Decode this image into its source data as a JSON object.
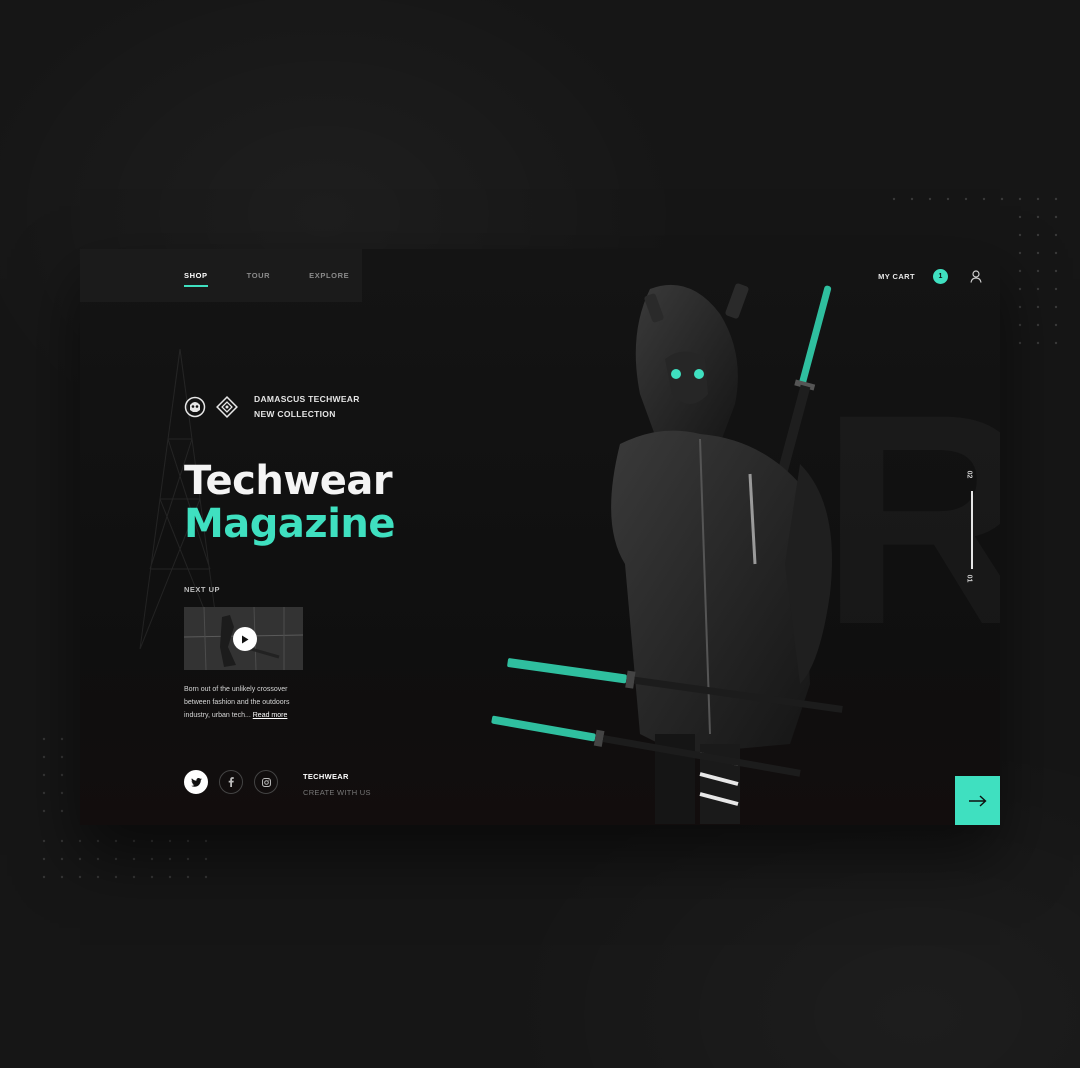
{
  "nav": {
    "items": [
      {
        "label": "SHOP",
        "active": true
      },
      {
        "label": "TOUR",
        "active": false
      },
      {
        "label": "EXPLORE",
        "active": false
      }
    ]
  },
  "header": {
    "cart_label": "MY CART",
    "cart_count": "1",
    "user_icon": "user-icon"
  },
  "brand": {
    "line1": "DAMASCUS TECHWEAR",
    "line2": "NEW COLLECTION",
    "icons": [
      "skull-badge-icon",
      "diamond-logo-icon"
    ]
  },
  "headline": {
    "line1": "Techwear",
    "line2": "Magazine"
  },
  "next_up": {
    "label": "NEXT UP",
    "description": "Born out of the unlikely crossover between fashion and the outdoors industry, urban tech...",
    "read_more": "Read more"
  },
  "social": {
    "icons": [
      "twitter-icon",
      "facebook-icon",
      "instagram-icon"
    ]
  },
  "footer": {
    "title": "TECHWEAR",
    "subtitle": "CREATE WITH US"
  },
  "pager": {
    "top": "02",
    "bottom": "01"
  },
  "colors": {
    "accent": "#3fe0c0",
    "background": "#161616",
    "card": "#111111"
  }
}
